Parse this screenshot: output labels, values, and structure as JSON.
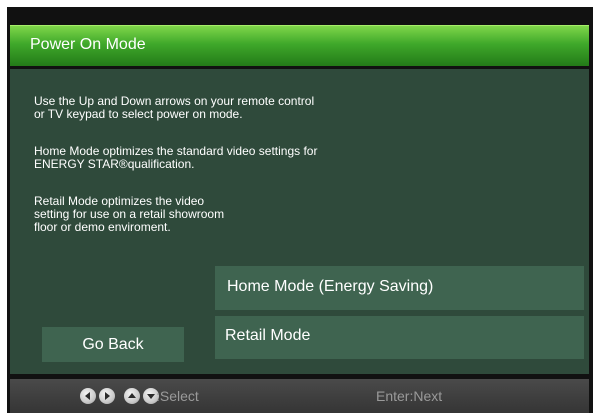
{
  "title": "Power On Mode",
  "description": {
    "paragraph1": [
      "Use the Up and Down arrows on your remote control",
      "or TV keypad to select power on mode."
    ],
    "paragraph2": [
      "Home Mode optimizes the standard video settings for",
      "ENERGY STAR®qualification."
    ],
    "paragraph3": [
      "Retail Mode optimizes the video",
      "setting for use on a retail showroom",
      "floor or demo enviroment."
    ]
  },
  "options": [
    {
      "label": "Home Mode (Energy Saving)"
    },
    {
      "label": "Retail Mode"
    }
  ],
  "go_back_label": "Go Back",
  "footer": {
    "nav_icons": [
      "left-arrow-icon",
      "right-arrow-icon",
      "up-arrow-icon",
      "down-arrow-icon"
    ],
    "select_label": ":Select",
    "enter_label": "Enter:Next"
  },
  "colors": {
    "title_bar": "#3fa82a",
    "panel": "#2f4a3b",
    "button": "#3f6450",
    "footer_text": "#9a9a9a"
  }
}
